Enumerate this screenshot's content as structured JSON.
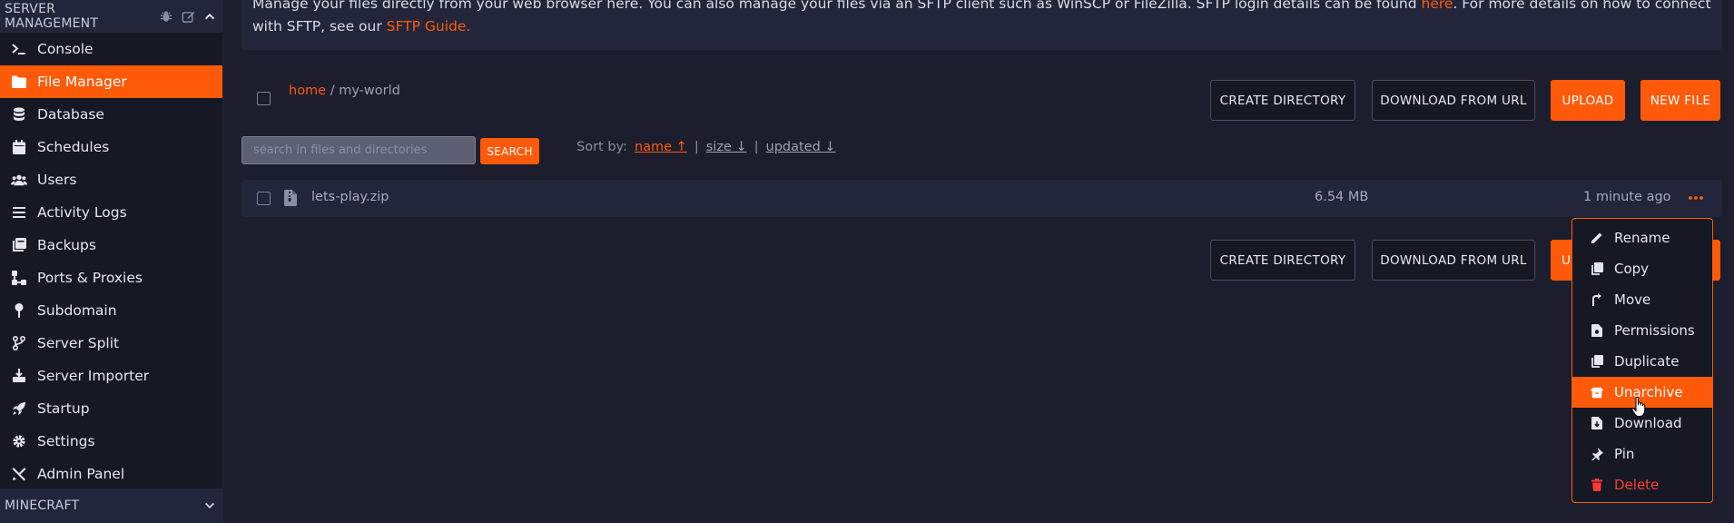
{
  "sidebar": {
    "section_title": "SERVER MANAGEMENT",
    "items": [
      {
        "label": "Console",
        "icon": "terminal-icon"
      },
      {
        "label": "File Manager",
        "icon": "folder-icon"
      },
      {
        "label": "Database",
        "icon": "database-icon"
      },
      {
        "label": "Schedules",
        "icon": "calendar-icon"
      },
      {
        "label": "Users",
        "icon": "users-icon"
      },
      {
        "label": "Activity Logs",
        "icon": "list-icon"
      },
      {
        "label": "Backups",
        "icon": "backup-icon"
      },
      {
        "label": "Ports & Proxies",
        "icon": "network-icon"
      },
      {
        "label": "Subdomain",
        "icon": "pin-icon"
      },
      {
        "label": "Server Split",
        "icon": "split-icon"
      },
      {
        "label": "Server Importer",
        "icon": "import-icon"
      },
      {
        "label": "Startup",
        "icon": "rocket-icon"
      },
      {
        "label": "Settings",
        "icon": "gear-icon"
      },
      {
        "label": "Admin Panel",
        "icon": "tools-icon"
      }
    ],
    "bottom_section_title": "MINECRAFT"
  },
  "notice": {
    "line1_text": "Manage your files directly from your web browser here. You can also manage your files via an SFTP client such as WinSCP or FileZilla. SFTP login details can be found ",
    "line1_link": "here",
    "line1_after": ". For more details on how to connect",
    "line2_text": "with SFTP, see our ",
    "line2_link": "SFTP Guide."
  },
  "breadcrumb": {
    "home": "home",
    "separator": "/",
    "current": "my-world"
  },
  "toolbar": {
    "create_directory": "CREATE DIRECTORY",
    "download_from_url": "DOWNLOAD FROM URL",
    "upload": "UPLOAD",
    "new_file": "NEW FILE",
    "upload_partial": "U"
  },
  "search": {
    "placeholder": "search in files and directories",
    "button": "SEARCH"
  },
  "sort": {
    "label": "Sort by:",
    "name": "name ↑",
    "size": "size ↓",
    "updated": "updated ↓",
    "separator": "|"
  },
  "files": [
    {
      "name": "lets-play.zip",
      "size": "6.54 MB",
      "updated": "1 minute ago"
    }
  ],
  "context_menu": {
    "items": [
      {
        "label": "Rename",
        "icon": "pencil-icon"
      },
      {
        "label": "Copy",
        "icon": "copy-icon"
      },
      {
        "label": "Move",
        "icon": "move-icon"
      },
      {
        "label": "Permissions",
        "icon": "permissions-icon"
      },
      {
        "label": "Duplicate",
        "icon": "duplicate-icon"
      },
      {
        "label": "Unarchive",
        "icon": "box-open-icon"
      },
      {
        "label": "Download",
        "icon": "download-icon"
      },
      {
        "label": "Pin",
        "icon": "thumbtack-icon"
      },
      {
        "label": "Delete",
        "icon": "trash-icon"
      }
    ]
  },
  "colors": {
    "accent": "#ff5a0a",
    "background": "#1c1e2d",
    "panel": "#23263a",
    "sidebar": "#161824",
    "danger": "#ff3b30"
  }
}
